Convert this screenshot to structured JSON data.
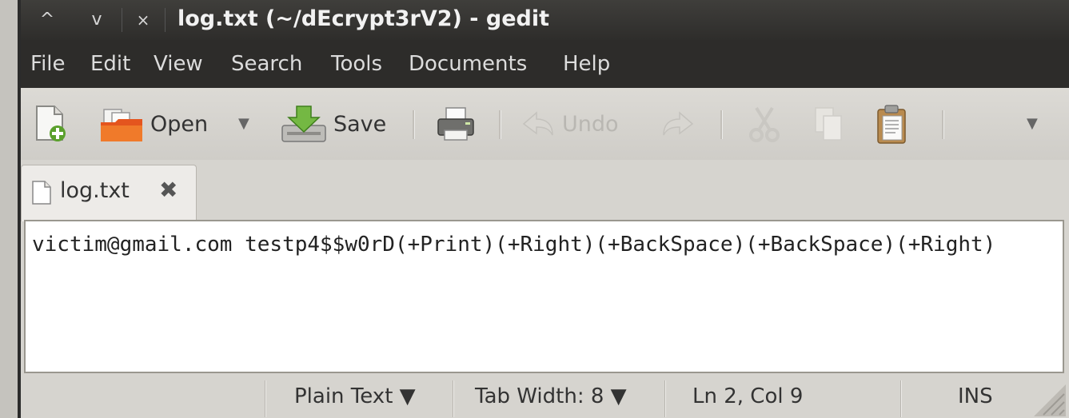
{
  "window": {
    "title": "log.txt (~/dEcrypt3rV2) - gedit",
    "controls": {
      "up": "^",
      "down": "v",
      "close": "×"
    }
  },
  "menu": [
    "File",
    "Edit",
    "View",
    "Search",
    "Tools",
    "Documents",
    "Help"
  ],
  "toolbar": {
    "new_icon": "new-document-icon",
    "open_label": "Open",
    "open_dropdown": "▼",
    "save_label": "Save",
    "print_icon": "printer-icon",
    "undo_label": "Undo",
    "redo_icon": "redo-icon",
    "cut_icon": "scissors-icon",
    "copy_icon": "copy-icon",
    "paste_icon": "clipboard-icon",
    "overflow": "▼"
  },
  "tab": {
    "label": "log.txt",
    "close_glyph": "✖"
  },
  "editor": {
    "content": "victim@gmail.com testp4$$w0rD(+Print)(+Right)(+BackSpace)(+BackSpace)(+Right)"
  },
  "status": {
    "language": "Plain Text ▼",
    "tab_width": "Tab Width:  8 ▼",
    "position": "Ln 2, Col 9",
    "mode": "INS"
  }
}
